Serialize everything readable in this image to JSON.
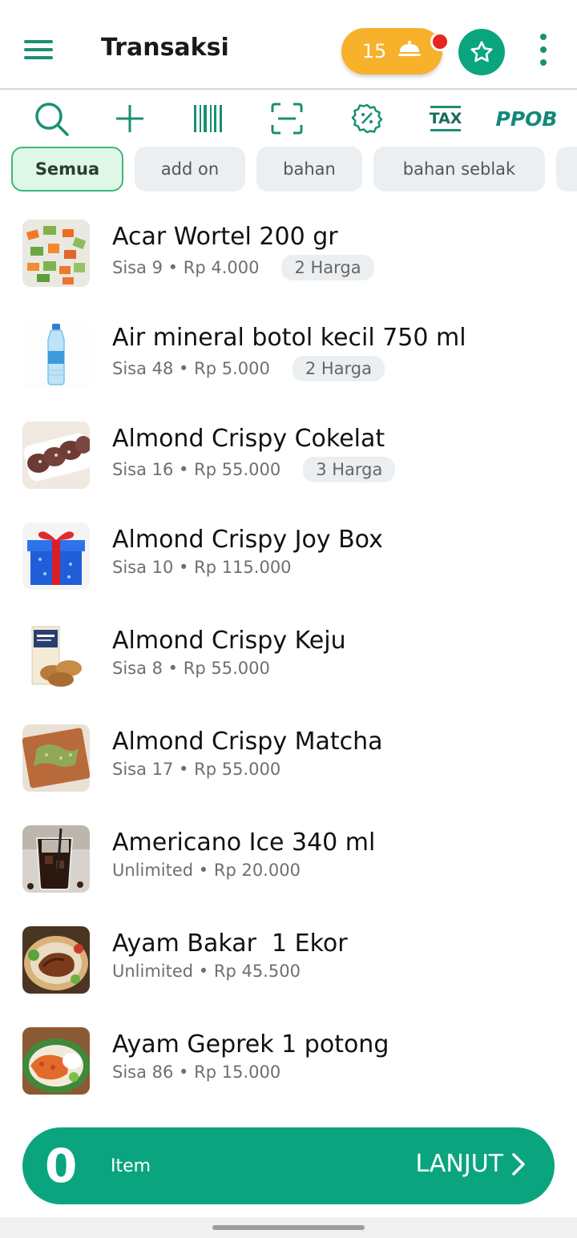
{
  "header": {
    "title": "Transaksi",
    "order_count": "15",
    "accent_color": "#0aa57f",
    "icons": [
      "menu-icon",
      "food-cloche-icon",
      "star-icon",
      "more-vert-icon"
    ]
  },
  "toolbar": {
    "icons": [
      "search-icon",
      "add-icon",
      "barcode-icon",
      "scan-icon",
      "discount-icon",
      "tax-icon"
    ],
    "tax_label": "TAX",
    "ppob_label": "PPOB"
  },
  "categories": [
    "Semua",
    "add on",
    "bahan",
    "bahan seblak"
  ],
  "products": [
    {
      "name": "Acar Wortel 200 gr",
      "meta": "Sisa 9 • Rp 4.000",
      "badge": "2 Harga"
    },
    {
      "name": "Air mineral botol kecil 750 ml",
      "meta": "Sisa 48 • Rp 5.000",
      "badge": "2 Harga"
    },
    {
      "name": "Almond Crispy Cokelat",
      "meta": "Sisa 16 • Rp 55.000",
      "badge": "3 Harga"
    },
    {
      "name": "Almond Crispy Joy Box",
      "meta": "Sisa 10 • Rp 115.000",
      "badge": ""
    },
    {
      "name": "Almond Crispy Keju",
      "meta": "Sisa 8 • Rp 55.000",
      "badge": ""
    },
    {
      "name": "Almond Crispy Matcha",
      "meta": "Sisa 17 • Rp 55.000",
      "badge": ""
    },
    {
      "name": "Americano Ice 340 ml",
      "meta": "Unlimited • Rp 20.000",
      "badge": ""
    },
    {
      "name": "Ayam Bakar  1 Ekor",
      "meta": "Unlimited • Rp 45.500",
      "badge": ""
    },
    {
      "name": "Ayam Geprek 1 potong",
      "meta": "Sisa 86 • Rp 15.000",
      "badge": ""
    }
  ],
  "checkout": {
    "count": "0",
    "count_label": "Item",
    "next_label": "LANJUT"
  }
}
